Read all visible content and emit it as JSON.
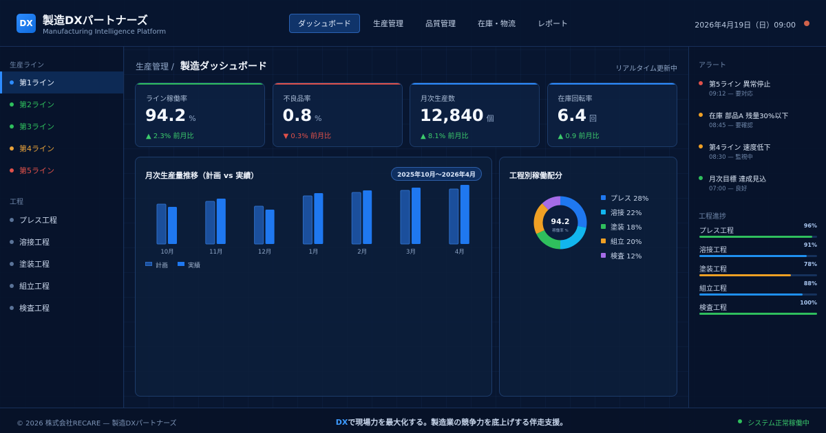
{
  "header": {
    "logo": "DX",
    "title": "製造DXパートナーズ",
    "subtitle": "Manufacturing Intelligence Platform",
    "nav": [
      "ダッシュボード",
      "生産管理",
      "品質管理",
      "在庫・物流",
      "レポート"
    ],
    "nav_active": 0,
    "datetime": "2026年4月19日（日）09:00"
  },
  "sidebar": {
    "lines_heading": "生産ライン",
    "lines": [
      {
        "label": "第1ライン",
        "color": "#2d8cff",
        "active": true
      },
      {
        "label": "第2ライン",
        "color": "#2fbf5d"
      },
      {
        "label": "第3ライン",
        "color": "#2fbf5d"
      },
      {
        "label": "第4ライン",
        "color": "#e8a23a"
      },
      {
        "label": "第5ライン",
        "color": "#e0514a"
      }
    ],
    "process_heading": "工程",
    "processes": [
      "プレス工程",
      "溶接工程",
      "塗装工程",
      "組立工程",
      "検査工程"
    ]
  },
  "main": {
    "breadcrumb": "生産管理 /",
    "title": "製造ダッシュボード",
    "realtime": "リアルタイム更新中",
    "kpis": [
      {
        "label": "ライン稼働率",
        "value": "94.2",
        "unit": "%",
        "delta": "▲ 2.3% 前月比",
        "trend": "up",
        "accent": "#2fbf5d"
      },
      {
        "label": "不良品率",
        "value": "0.8",
        "unit": "%",
        "delta": "▼ 0.3% 前月比",
        "trend": "down",
        "accent": "#e0514a"
      },
      {
        "label": "月次生産数",
        "value": "12,840",
        "unit": "個",
        "delta": "▲ 8.1% 前月比",
        "trend": "up",
        "accent": "#2d8cff"
      },
      {
        "label": "在庫回転率",
        "value": "6.4",
        "unit": "回",
        "delta": "▲ 0.9 前月比",
        "trend": "up",
        "accent": "#2d8cff"
      }
    ]
  },
  "bar_panel": {
    "title": "月次生産量推移（計画 vs 実績）",
    "period": "2025年10月〜2026年4月",
    "legend_plan": "計画",
    "legend_actual": "実績"
  },
  "donut_panel": {
    "title": "工程別稼働配分",
    "center_value": "94.2",
    "center_label": "稼働率 %",
    "legend": [
      "プレス 28%",
      "溶接 22%",
      "塗装 18%",
      "組立 20%",
      "検査 12%"
    ]
  },
  "chart_data": [
    {
      "type": "bar",
      "title": "月次生産量推移（計画 vs 実績）",
      "categories": [
        "10月",
        "11月",
        "12月",
        "1月",
        "2月",
        "3月",
        "4月"
      ],
      "series": [
        {
          "name": "計画",
          "values": [
            58,
            62,
            55,
            70,
            75,
            78,
            80
          ],
          "color": "#1b4f9c"
        },
        {
          "name": "実績",
          "values": [
            54,
            66,
            50,
            74,
            78,
            82,
            86
          ],
          "color": "#1f78f0"
        }
      ],
      "ylim": [
        0,
        100
      ]
    },
    {
      "type": "pie",
      "title": "工程別稼働配分",
      "labels": [
        "プレス",
        "溶接",
        "塗装",
        "組立",
        "検査"
      ],
      "values": [
        28,
        22,
        18,
        20,
        12
      ],
      "colors": [
        "#1f78f0",
        "#12b6ee",
        "#2fbf5d",
        "#f0a024",
        "#a66ce8"
      ]
    }
  ],
  "alerts": {
    "heading": "アラート",
    "items": [
      {
        "title": "第5ライン 異常停止",
        "meta": "09:12 — 要対応",
        "color": "#e0514a"
      },
      {
        "title": "在庫 部品A 残量30%以下",
        "meta": "08:45 — 要確認",
        "color": "#f0a024"
      },
      {
        "title": "第4ライン 速度低下",
        "meta": "08:30 — 監視中",
        "color": "#f0a024"
      },
      {
        "title": "月次目標 達成見込",
        "meta": "07:00 — 良好",
        "color": "#2fbf5d"
      }
    ]
  },
  "progress": {
    "heading": "工程進捗",
    "items": [
      {
        "label": "プレス工程",
        "percent": 96,
        "display": "96%",
        "color": "#2fbf5d"
      },
      {
        "label": "溶接工程",
        "percent": 91,
        "display": "91%",
        "color": "#1f90f0"
      },
      {
        "label": "塗装工程",
        "percent": 78,
        "display": "78%",
        "color": "#f0a024"
      },
      {
        "label": "組立工程",
        "percent": 88,
        "display": "88%",
        "color": "#1f90f0"
      },
      {
        "label": "検査工程",
        "percent": 100,
        "display": "100%",
        "color": "#2fbf5d"
      }
    ]
  },
  "footer": {
    "copyright": "© 2026 株式会社RECARE — 製造DXパートナーズ",
    "slogan_highlight": "DX",
    "slogan_rest": "で現場力を最大化する。製造業の競争力を底上げする伴走支援。",
    "status": "システム正常稼働中"
  }
}
